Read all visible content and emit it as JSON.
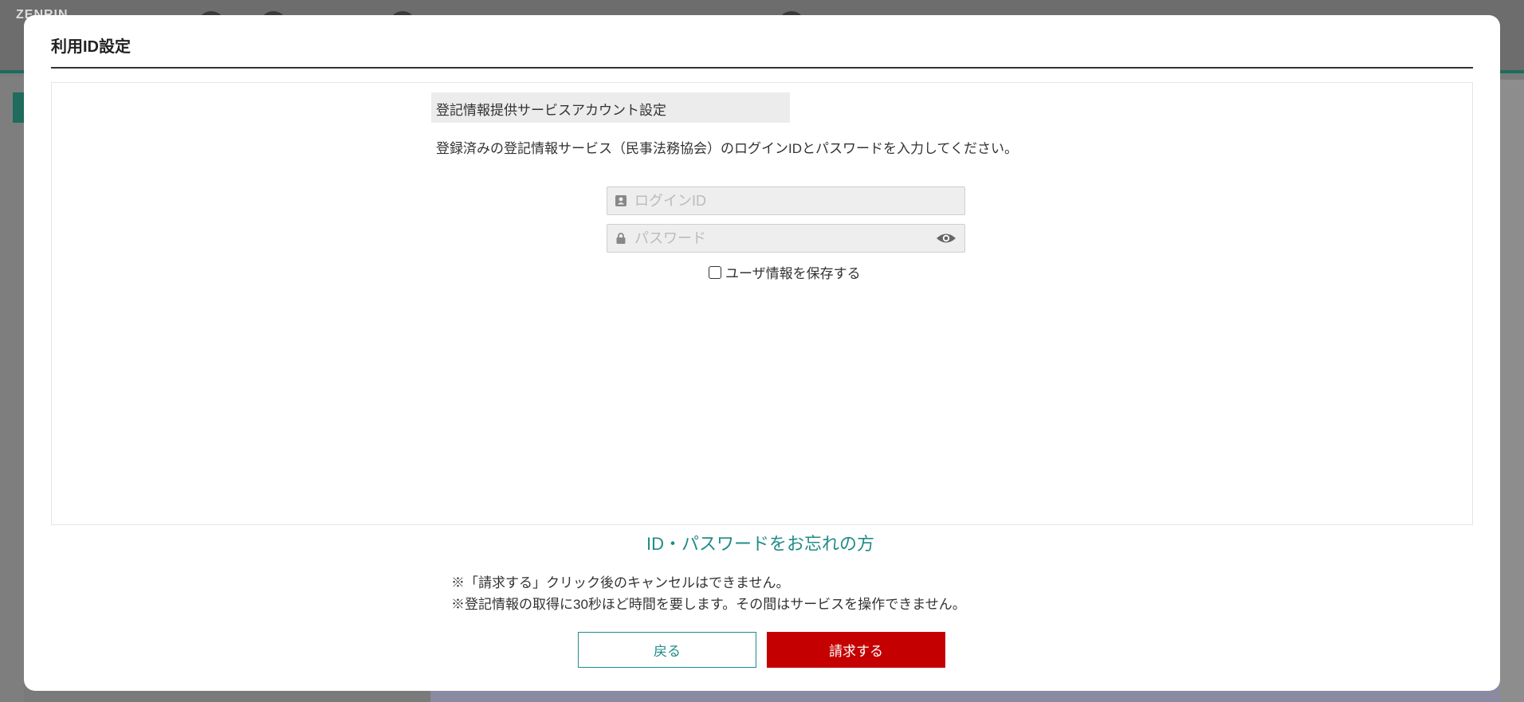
{
  "background": {
    "logo": "ZENRIN"
  },
  "modal": {
    "title": "利用ID設定",
    "section_header": "登記情報提供サービスアカウント設定",
    "instructions": "登録済みの登記情報サービス（民事法務協会）のログインIDとパスワードを入力してください。",
    "login_id": {
      "value": "",
      "placeholder": "ログインID",
      "icon": "id-card-icon"
    },
    "password": {
      "value": "",
      "placeholder": "パスワード",
      "icon": "lock-icon",
      "toggle_icon": "eye-icon"
    },
    "remember_label": "ユーザ情報を保存する",
    "remember_checked": false,
    "forgot_link": "ID・パスワードをお忘れの方",
    "notes": [
      "※「請求する」クリック後のキャンセルはできません。",
      "※登記情報の取得に30秒ほど時間を要します。その間はサービスを操作できません。"
    ],
    "buttons": {
      "back": "戻る",
      "submit": "請求する"
    }
  },
  "colors": {
    "accent_teal": "#1f8c88",
    "submit_red": "#c40000",
    "overlay": "#6b6b6b"
  }
}
